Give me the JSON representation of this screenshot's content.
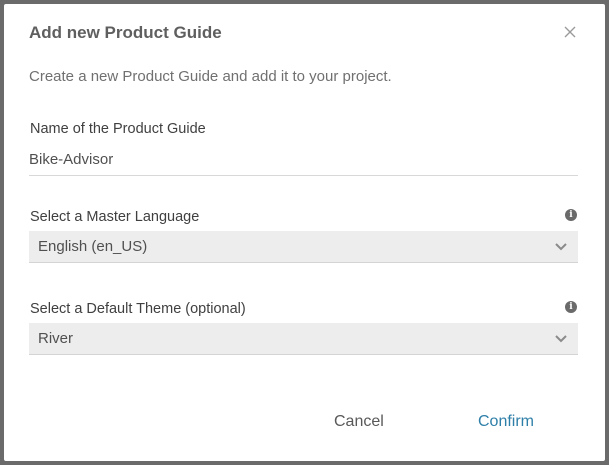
{
  "dialog": {
    "title": "Add new Product Guide",
    "subtitle": "Create a new Product Guide and add it to your project.",
    "close_icon": "close-icon"
  },
  "name_field": {
    "label": "Name of the Product Guide",
    "value": "Bike-Advisor"
  },
  "language_field": {
    "label": "Select a Master Language",
    "value": "English (en_US)",
    "info_icon": "info-icon",
    "dropdown_icon": "chevron-down-icon"
  },
  "theme_field": {
    "label": "Select a Default Theme (optional)",
    "value": "River",
    "info_icon": "info-icon",
    "dropdown_icon": "chevron-down-icon"
  },
  "actions": {
    "cancel_label": "Cancel",
    "confirm_label": "Confirm"
  },
  "colors": {
    "overlay": "#6b6b6b",
    "accent": "#2e7fa8",
    "select_bg": "#ededed"
  }
}
